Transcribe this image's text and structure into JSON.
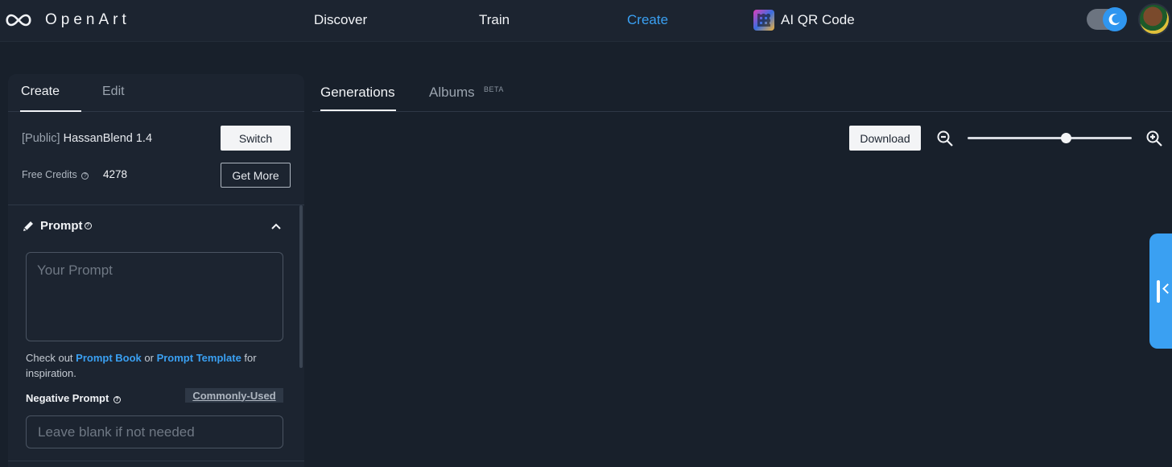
{
  "nav": {
    "brand": "OpenArt",
    "items": [
      {
        "label": "Discover",
        "active": false
      },
      {
        "label": "Train",
        "active": false
      },
      {
        "label": "Create",
        "active": true
      },
      {
        "label": "AI QR Code",
        "active": false
      }
    ],
    "accent_color": "#3aa0f2"
  },
  "left_panel": {
    "tabs": [
      "Create",
      "Edit"
    ],
    "model_prefix": "[Public]",
    "model_name": "HassanBlend 1.4",
    "switch_label": "Switch",
    "credits_label": "Free Credits",
    "credits_value": "4278",
    "get_more_label": "Get More",
    "prompt_title": "Prompt",
    "prompt_placeholder": "Your Prompt",
    "hint": {
      "pre": "Check out ",
      "link1": "Prompt Book",
      "mid": " or ",
      "link2": "Prompt Template",
      "post": " for inspiration."
    },
    "negative_title": "Negative Prompt",
    "commonly_used_label": "Commonly-Used",
    "negative_placeholder": "Leave blank if not needed"
  },
  "gallery": {
    "tabs": [
      "Generations",
      "Albums"
    ],
    "albums_badge": "BETA",
    "download_label": "Download",
    "zoom_level": 0.6,
    "thumbnails": [
      {
        "name": "gen-image-1",
        "palette": [
          "#d6dbe0",
          "#8a929a",
          "#2a2c30"
        ]
      },
      {
        "name": "gen-image-2",
        "palette": [
          "#9eb0c2",
          "#5a6a7a",
          "#b45a58"
        ]
      },
      {
        "name": "gen-image-3",
        "palette": [
          "#3c5e66",
          "#c9ced2",
          "#e8eaec"
        ]
      },
      {
        "name": "gen-image-4",
        "palette": [
          "#d5d7d6",
          "#6e6e6c",
          "#1c1c1c"
        ]
      },
      {
        "name": "gen-image-5",
        "palette": [
          "#c4c6c6",
          "#5d5e5f",
          "#202124"
        ]
      },
      {
        "name": "gen-image-6",
        "palette": [
          "#b5b0a8",
          "#6e6458",
          "#2a2520"
        ]
      },
      {
        "name": "gen-image-7",
        "palette": [
          "#b8b8b4",
          "#706c66",
          "#262422"
        ]
      },
      {
        "name": "gen-image-8",
        "palette": [
          "#9ea4a6",
          "#e8e6e4",
          "#4a4c50"
        ]
      },
      {
        "name": "gen-image-9",
        "palette": [
          "#b4b2ae",
          "#e4e2de",
          "#3a3430"
        ]
      },
      {
        "name": "gen-image-10",
        "palette": [
          "#8e8a86",
          "#cfcfcf",
          "#1c1c1c"
        ]
      },
      {
        "name": "gen-image-11",
        "palette": [
          "#9aa6ae",
          "#d8d8d8",
          "#2a2a2a"
        ]
      },
      {
        "name": "gen-image-12",
        "palette": [
          "#6a5246",
          "#c08a62",
          "#1a1614"
        ]
      },
      {
        "name": "gen-image-13",
        "palette": [
          "#5a4438",
          "#8a5a3a",
          "#1c1614"
        ]
      },
      {
        "name": "gen-image-14",
        "palette": [
          "#c8a890",
          "#22b0c0",
          "#6a4a34"
        ]
      },
      {
        "name": "gen-image-15",
        "palette": [
          "#d2d2d2",
          "#6a4630",
          "#111111"
        ]
      },
      {
        "name": "gen-image-16",
        "palette": [
          "#587a48",
          "#e0d02a",
          "#6a4430"
        ]
      },
      {
        "name": "gen-image-17",
        "palette": [
          "#c8a890",
          "#f0389e",
          "#6a4a34"
        ]
      },
      {
        "name": "gen-image-18",
        "palette": [
          "#3a3c40",
          "#6a4a3a",
          "#121212"
        ]
      },
      {
        "name": "gen-image-19",
        "palette": [
          "#9ea8ae",
          "#5a4a40",
          "#1a1a1a"
        ]
      },
      {
        "name": "gen-image-20",
        "palette": [
          "#2a2e34",
          "#e0508a",
          "#1a1a1a"
        ]
      },
      {
        "name": "gen-image-21",
        "palette": [
          "#3a3236",
          "#c02aa0",
          "#6a4430"
        ]
      },
      {
        "name": "gen-image-22",
        "palette": [
          "#2ad8d0",
          "#d02ab0",
          "#1c1c24"
        ]
      },
      {
        "name": "gen-image-23",
        "palette": [
          "#f0f0f0",
          "#e030a8",
          "#2a2a2a"
        ]
      },
      {
        "name": "gen-image-24",
        "palette": [
          "#f4f0f2",
          "#e83aa8",
          "#3a2a30"
        ]
      }
    ]
  }
}
